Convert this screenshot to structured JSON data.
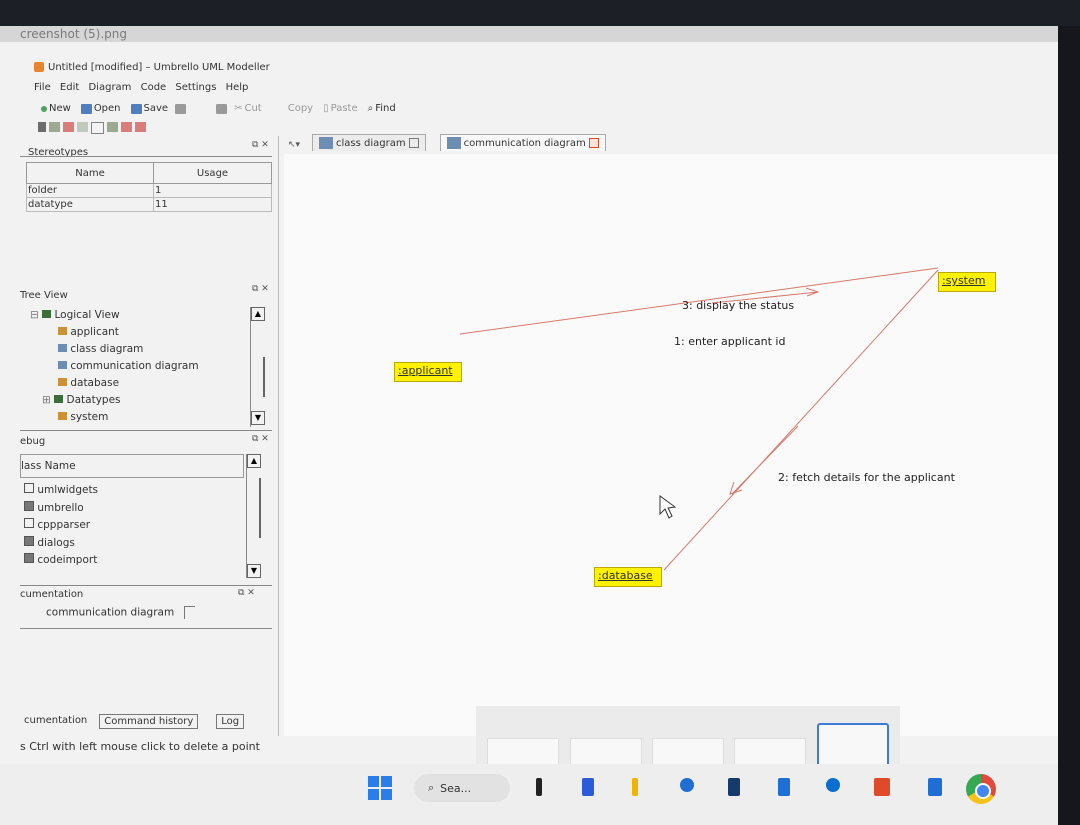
{
  "file_title": "creenshot (5).png",
  "window_title": "Untitled [modified] – Umbrello UML Modeller",
  "menu": [
    "File",
    "Edit",
    "Diagram",
    "Code",
    "Settings",
    "Help"
  ],
  "toolbar": {
    "new": "New",
    "open": "Open",
    "save": "Save",
    "cut": "Cut",
    "copy": "Copy",
    "paste": "Paste",
    "find": "Find"
  },
  "stereotypes": {
    "title": "Stereotypes",
    "headers": [
      "Name",
      "Usage"
    ],
    "rows": [
      {
        "name": "folder",
        "usage": "1"
      },
      {
        "name": "datatype",
        "usage": "11"
      }
    ]
  },
  "tree_view": {
    "title": "Tree View",
    "root": "Logical View",
    "items": [
      "applicant",
      "class diagram",
      "communication diagram",
      "database",
      "Datatypes",
      "system"
    ]
  },
  "debug": {
    "title": "ebug",
    "header": "lass Name",
    "items": [
      {
        "label": "umlwidgets",
        "checked": false
      },
      {
        "label": "umbrello",
        "checked": true
      },
      {
        "label": "cppparser",
        "checked": false
      },
      {
        "label": "dialogs",
        "checked": true
      },
      {
        "label": "codeimport",
        "checked": true
      }
    ]
  },
  "documentation": {
    "title": "cumentation",
    "diagram_label": "communication diagram"
  },
  "bottom_tabs": [
    "cumentation",
    "Command history",
    "Log"
  ],
  "status_text": "s Ctrl with left mouse click to delete a point",
  "diagram_tabs": [
    {
      "label": "class diagram",
      "active": false
    },
    {
      "label": "communication diagram",
      "active": true
    }
  ],
  "diagram": {
    "objects": {
      "applicant": ":applicant",
      "system": ":system",
      "database": ":database"
    },
    "messages": [
      "3: display the status",
      "1: enter applicant id",
      "2: fetch details for the applicant"
    ]
  },
  "taskbar": {
    "search_text": "Sea..."
  }
}
